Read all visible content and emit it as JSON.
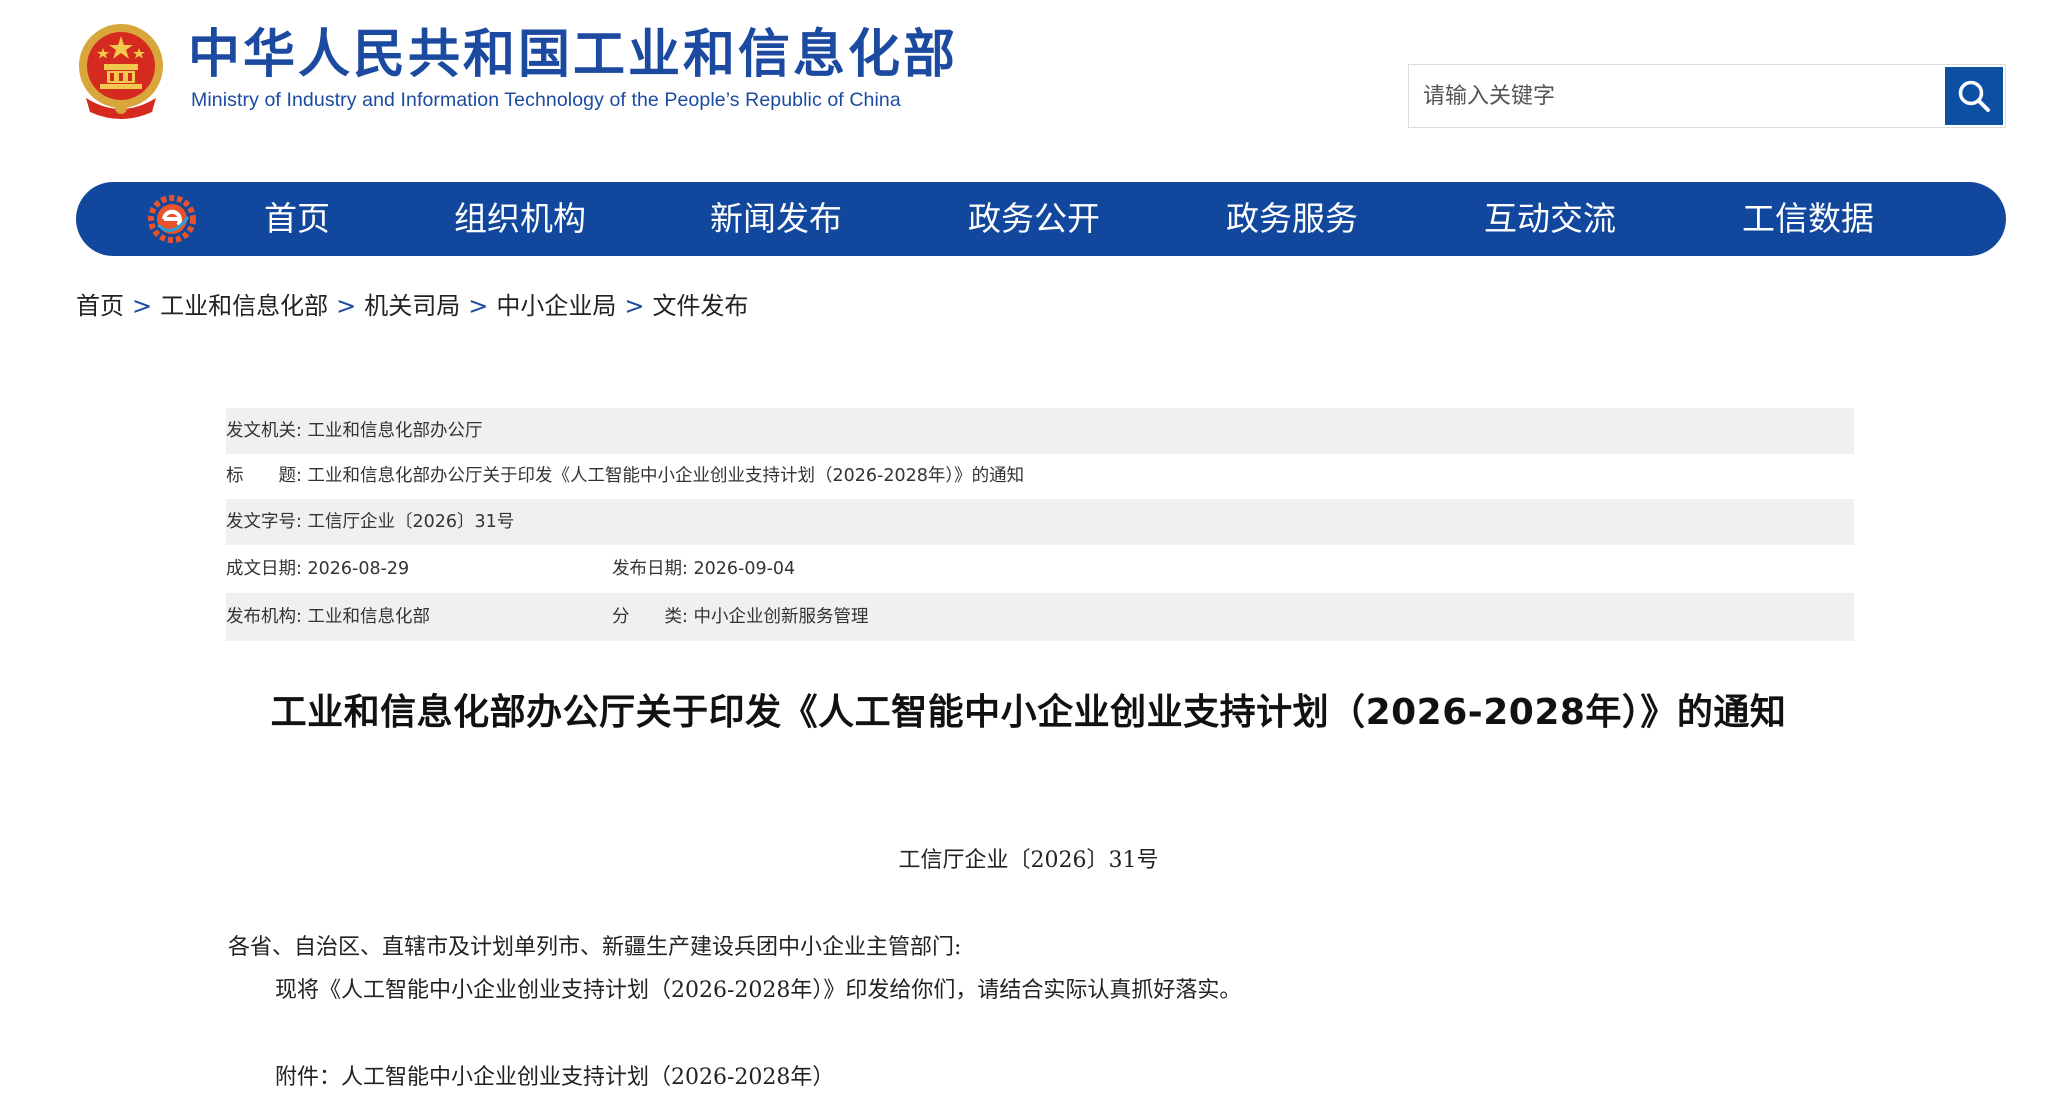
{
  "header": {
    "title": "中华人民共和国工业和信息化部",
    "subtitle": "Ministry of Industry and Information Technology of the People’s Republic of China",
    "emblem_icon": "national-emblem-icon",
    "brand_color": "#1b4aa0"
  },
  "search": {
    "placeholder": "请输入关键字",
    "button_icon": "search-icon",
    "button_color": "#0c4fa3"
  },
  "nav": {
    "logo_icon": "miit-gear-logo-icon",
    "bar_color": "#11479c",
    "items": [
      "首页",
      "组织机构",
      "新闻发布",
      "政务公开",
      "政务服务",
      "互动交流",
      "工信数据"
    ]
  },
  "breadcrumb": {
    "items": [
      "首页",
      "工业和信息化部",
      "机关司局",
      "中小企业局",
      "文件发布"
    ],
    "separator": ">"
  },
  "meta": {
    "issuer_label": "发文机关:",
    "issuer": "工业和信息化部办公厅",
    "title_label": "标　　题:",
    "title": "工业和信息化部办公厅关于印发《人工智能中小企业创业支持计划（2026-2028年）》的通知",
    "docno_label": "发文字号:",
    "docno": "工信厅企业〔2026〕31号",
    "written_label": "成文日期:",
    "written": "2026-08-29",
    "published_label": "发布日期:",
    "published": "2026-09-04",
    "org_label": "发布机构:",
    "org": "工业和信息化部",
    "category_label": "分　　类:",
    "category": "中小企业创新服务管理"
  },
  "article": {
    "title": "工业和信息化部办公厅关于印发《人工智能中小企业创业支持计划（2026-2028年）》的通知",
    "doc_number": "工信厅企业〔2026〕31号",
    "salutation": "各省、自治区、直辖市及计划单列市、新疆生产建设兵团中小企业主管部门:",
    "paragraph": "现将《人工智能中小企业创业支持计划（2026-2028年）》印发给你们，请结合实际认真抓好落实。",
    "attachment": "附件：人工智能中小企业创业支持计划（2026-2028年）"
  }
}
